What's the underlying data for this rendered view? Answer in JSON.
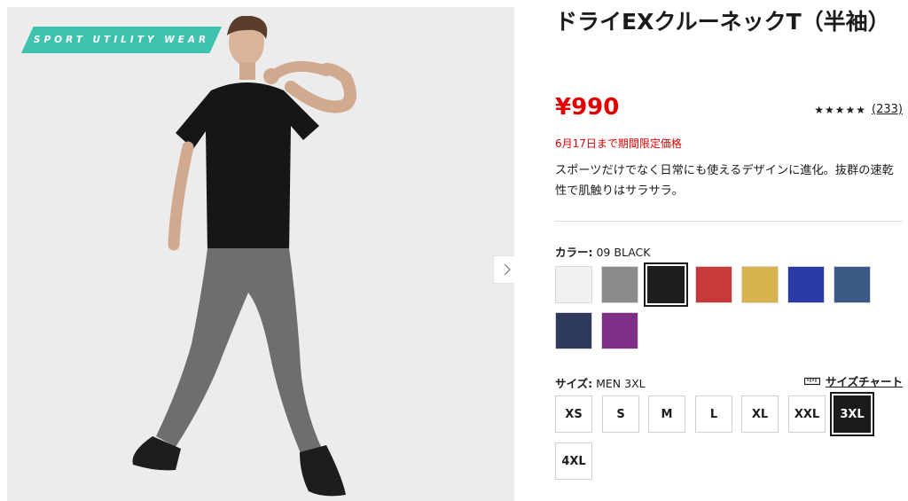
{
  "image": {
    "badge_text": "SPORT UTILITY WEAR",
    "next_arrow_icon": "chevron-right-icon",
    "colors": {
      "background": "#ececec",
      "badge": "#3cc2ad",
      "tshirt": "#161616",
      "pants": "#6e6e6e"
    }
  },
  "product": {
    "title": "ドライEXクルーネックT（半袖）",
    "price": "¥990",
    "rating_stars": "★★★★★",
    "review_count": "(233)",
    "promo": "6月17日まで期間限定価格",
    "description": "スポーツだけでなく日常にも使えるデザインに進化。抜群の速乾性で肌触りはサラサラ。"
  },
  "color": {
    "label": "カラー:",
    "selected_value": "09 BLACK",
    "swatches": [
      {
        "name": "white",
        "hex": "#f1f1f1"
      },
      {
        "name": "gray",
        "hex": "#8b8b8b"
      },
      {
        "name": "black",
        "hex": "#1d1d1d",
        "selected": true
      },
      {
        "name": "red",
        "hex": "#c8393b"
      },
      {
        "name": "yellow",
        "hex": "#d8b24f"
      },
      {
        "name": "blue",
        "hex": "#2b3aa8"
      },
      {
        "name": "steel-blue",
        "hex": "#3d5a87"
      },
      {
        "name": "navy",
        "hex": "#2e3a5c"
      },
      {
        "name": "purple",
        "hex": "#7e2f86"
      }
    ]
  },
  "size": {
    "label": "サイズ:",
    "selected_value": "MEN 3XL",
    "chart_label": "サイズチャート",
    "chart_icon": "ruler-icon",
    "options": [
      "XS",
      "S",
      "M",
      "L",
      "XL",
      "XXL",
      "3XL",
      "4XL"
    ],
    "selected": "3XL"
  }
}
